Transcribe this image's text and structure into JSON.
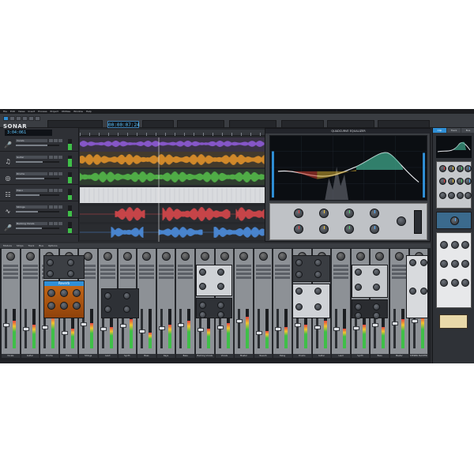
{
  "app": {
    "name": "SONAR",
    "menu": [
      "File",
      "Edit",
      "Views",
      "Insert",
      "Process",
      "Project",
      "Utilities",
      "Window",
      "Help"
    ],
    "transport_time": "00:00:07:24",
    "now_time": "3:04:061"
  },
  "colors": {
    "accent": "#2f8fd6",
    "track_purple": "#8e5bd6",
    "track_orange": "#e0922b",
    "track_green": "#54b94a",
    "track_red": "#d8484c",
    "track_blue": "#4d8fe0"
  },
  "tracks": [
    {
      "name": "Vocals",
      "icon": "microphone-icon",
      "vol": 0.72,
      "meter": 0.55
    },
    {
      "name": "Guitar",
      "icon": "guitar-icon",
      "vol": 0.62,
      "meter": 0.7
    },
    {
      "name": "Drums",
      "icon": "drum-icon",
      "vol": 0.66,
      "meter": 0.6
    },
    {
      "name": "Piano",
      "icon": "keyboard-icon",
      "vol": 0.55,
      "meter": 0.4
    },
    {
      "name": "Strings",
      "icon": "wave-icon",
      "vol": 0.5,
      "meter": 0.5
    },
    {
      "name": "Backing Vocals",
      "icon": "microphone-icon",
      "vol": 0.6,
      "meter": 0.45
    }
  ],
  "eq": {
    "title": "QUADCURVE EQUALIZER"
  },
  "console": {
    "menu": [
      "Module",
      "Strips",
      "Track",
      "Bus",
      "Options"
    ],
    "strips": [
      "Vocals",
      "Guitar",
      "Drums",
      "Piano",
      "Strings",
      "Lead",
      "Synth",
      "Bass",
      "Keys",
      "Bass",
      "Backing Vocals",
      "Vocals",
      "Master",
      "Reverb",
      "Delay",
      "Drums",
      "Guitar",
      "Lead",
      "Synth",
      "Bass",
      "Master",
      "STEREO MASTER"
    ],
    "reverb_label": "Reverb"
  },
  "inspector": {
    "tabs": [
      "Clip",
      "Track",
      "Bus"
    ]
  }
}
